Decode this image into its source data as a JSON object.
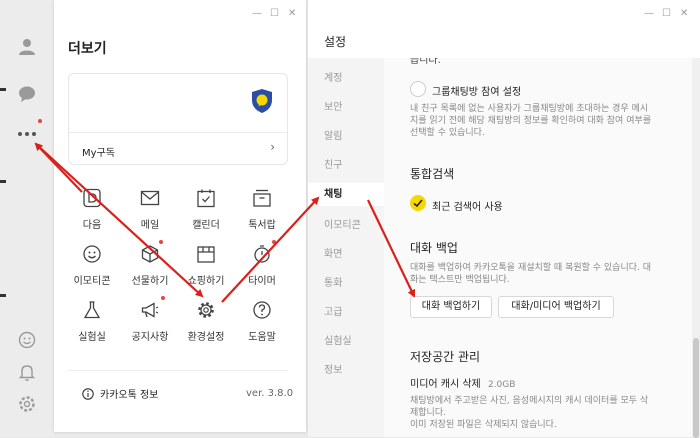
{
  "more_panel": {
    "title": "더보기",
    "window_controls": {
      "minimize": "—",
      "maximize": "☐",
      "close": "✕"
    },
    "card": {
      "label": "My구독",
      "chevron": "›"
    },
    "grid": [
      {
        "label": "다음",
        "icon": "daum-icon"
      },
      {
        "label": "메일",
        "icon": "mail-icon"
      },
      {
        "label": "캘린더",
        "icon": "calendar-icon"
      },
      {
        "label": "톡서랍",
        "icon": "drawer-icon"
      },
      {
        "label": "이모티콘",
        "icon": "emoticon-icon"
      },
      {
        "label": "선물하기",
        "icon": "gift-icon"
      },
      {
        "label": "쇼핑하기",
        "icon": "shopping-icon"
      },
      {
        "label": "타이머",
        "icon": "timer-icon"
      },
      {
        "label": "실험실",
        "icon": "flask-icon"
      },
      {
        "label": "공지사항",
        "icon": "megaphone-icon"
      },
      {
        "label": "환경설정",
        "icon": "gear-icon"
      },
      {
        "label": "도움말",
        "icon": "help-icon"
      }
    ],
    "footer": {
      "label": "카카오톡 정보",
      "version": "ver. 3.8.0"
    }
  },
  "settings": {
    "title": "설정",
    "nav": [
      "계정",
      "보안",
      "알림",
      "친구",
      "채팅",
      "이모티콘",
      "화면",
      "통화",
      "고급",
      "실험실",
      "정보"
    ],
    "active_nav": "채팅",
    "content": {
      "top_partial": "습니다.",
      "group_invite_label": "그룹채팅방 참여 설정",
      "group_invite_desc": [
        "내 친구 목록에 없는 사용자가 그룹채팅방에 초대하는 경우 메시",
        "지를 읽기 전에 해당 채팅방의 정보를 확인하여 대화 참여 여부를",
        "선택할 수 있습니다."
      ],
      "search_header": "통합검색",
      "search_option": "최근 검색어 사용",
      "backup_header": "대화 백업",
      "backup_desc": [
        "대화를 백업하여 카카오톡을 재설치할 때 복원할 수 있습니다. 대",
        "화는 텍스트만 백업됩니다."
      ],
      "backup_button": "대화 백업하기",
      "backup_media_button": "대화/미디어 백업하기",
      "storage_header": "저장공간 관리",
      "cache_label": "미디어 캐시 삭제",
      "cache_size": "2.0GB",
      "cache_desc": [
        "채팅방에서 주고받은 사진, 음성메시지의 캐시 데이터를 모두 삭",
        "제합니다.",
        "이미 저장된 파일은 삭제되지 않습니다."
      ]
    }
  },
  "colors": {
    "accent_yellow": "#f7d700",
    "shield_blue": "#2d4ca3",
    "annotation_red": "#d9201b"
  }
}
